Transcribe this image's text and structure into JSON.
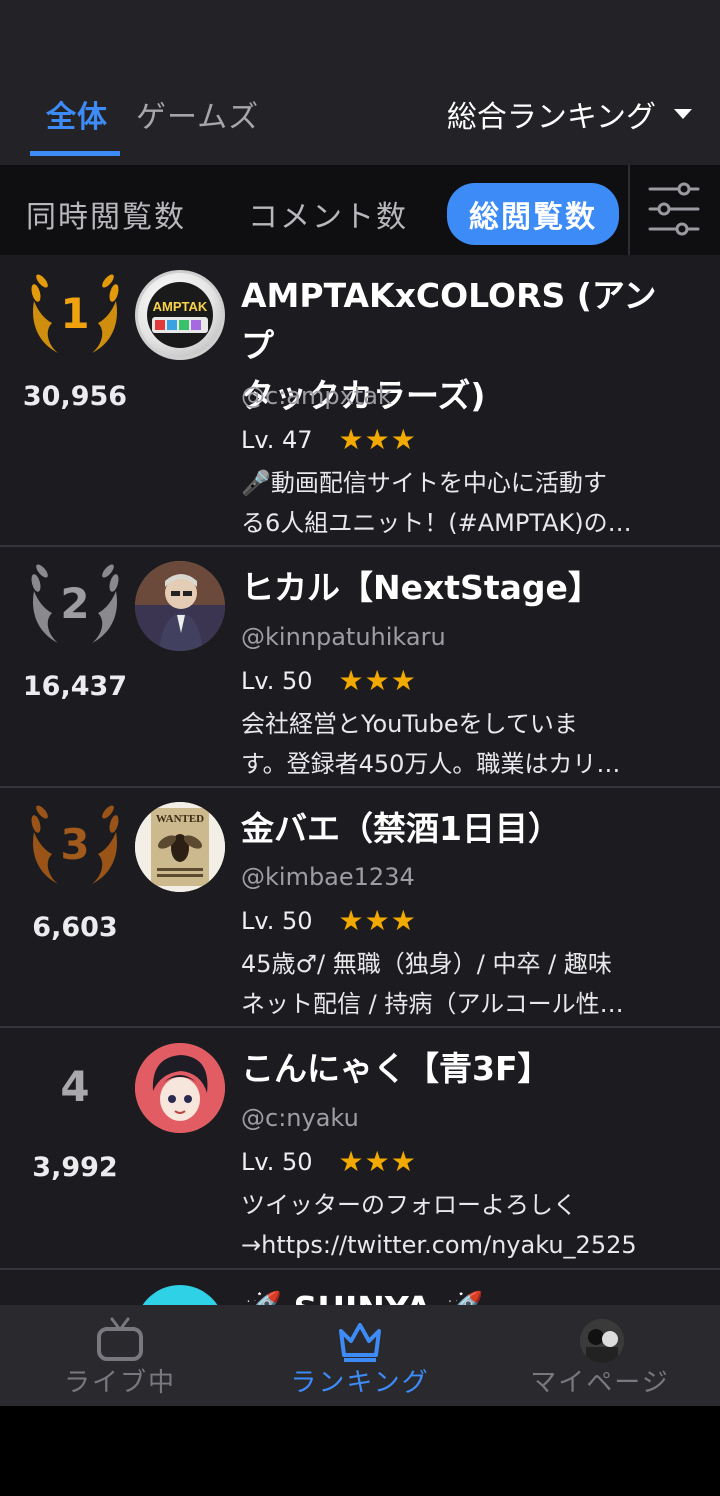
{
  "tabs": {
    "all": "全体",
    "games": "ゲームズ"
  },
  "ranking_select": "総合ランキング",
  "filters": [
    "同時閲覧数",
    "コメント数",
    "総閲覧数"
  ],
  "active_filter": "総閲覧数",
  "rows": [
    {
      "rank": "1",
      "views": "30,956",
      "name_line1": "AMPTAKxCOLORS (アンプ",
      "name_line2": "タックカラーズ)",
      "handle": "@c:ampxtak",
      "level": "Lv. 47",
      "stars": "★★★",
      "desc_line1": "🎤動画配信サイトを中心に活動す",
      "desc_line2": "る6人組ユニット！(#AMPTAK)の…",
      "avatar_text": "AMPTAK"
    },
    {
      "rank": "2",
      "views": "16,437",
      "name_line1": "ヒカル【NextStage】",
      "handle": "@kinnpatuhikaru",
      "level": "Lv. 50",
      "stars": "★★★",
      "desc_line1": "会社経営とYouTubeをしていま",
      "desc_line2": "す。登録者450万人。職業はカリ…"
    },
    {
      "rank": "3",
      "views": "6,603",
      "name_line1": "金バエ（禁酒1日目）",
      "handle": "@kimbae1234",
      "level": "Lv. 50",
      "stars": "★★★",
      "desc_line1": "45歳♂/ 無職（独身）/ 中卒 / 趣味",
      "desc_line2": "ネット配信 / 持病（アルコール性…",
      "avatar_text": "WANTED"
    },
    {
      "rank": "4",
      "views": "3,992",
      "name_line1": "こんにゃく【青3F】",
      "handle": "@c:nyaku",
      "level": "Lv. 50",
      "stars": "★★★",
      "desc_line1": "ツイッターのフォローよろしく",
      "desc_line2": "→https://twitter.com/nyaku_2525"
    },
    {
      "name_line1": "🚀 SHINYA 🚀"
    }
  ],
  "nav": {
    "live": "ライブ中",
    "ranking": "ランキング",
    "mypage": "マイページ"
  },
  "colors": {
    "accent": "#3d8bf7",
    "gold": "#e39b0b",
    "silver": "#8a8a8e",
    "bronze": "#9a5418",
    "star": "#f2a900"
  }
}
